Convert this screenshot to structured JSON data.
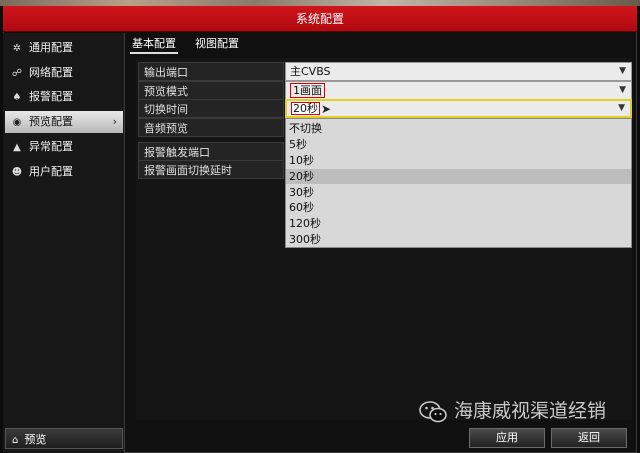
{
  "window": {
    "title": "系统配置"
  },
  "sidebar": {
    "items": [
      {
        "label": "通用配置",
        "icon": "gear-icon"
      },
      {
        "label": "网络配置",
        "icon": "network-icon"
      },
      {
        "label": "报警配置",
        "icon": "alarm-icon"
      },
      {
        "label": "预览配置",
        "icon": "eye-icon",
        "active": true
      },
      {
        "label": "异常配置",
        "icon": "warning-icon"
      },
      {
        "label": "用户配置",
        "icon": "users-icon"
      }
    ],
    "preview_label": "预览"
  },
  "tabs": [
    {
      "label": "基本配置",
      "active": true
    },
    {
      "label": "视图配置"
    }
  ],
  "form": {
    "output_port": {
      "label": "输出端口",
      "value": "主CVBS"
    },
    "preview_mode": {
      "label": "预览模式",
      "value": "1画面"
    },
    "switch_time": {
      "label": "切换时间",
      "value": "20秒"
    },
    "audio_preview": {
      "label": "音频预览"
    },
    "alarm_output": {
      "label": "报警触发端口"
    },
    "alarm_delay": {
      "label": "报警画面切换延时"
    }
  },
  "dropdown": {
    "options": [
      "不切换",
      "5秒",
      "10秒",
      "20秒",
      "30秒",
      "60秒",
      "120秒",
      "300秒"
    ],
    "selected": "20秒"
  },
  "footer": {
    "apply_label": "应用",
    "back_label": "返回"
  },
  "watermark": {
    "text": "海康威视渠道经销"
  }
}
